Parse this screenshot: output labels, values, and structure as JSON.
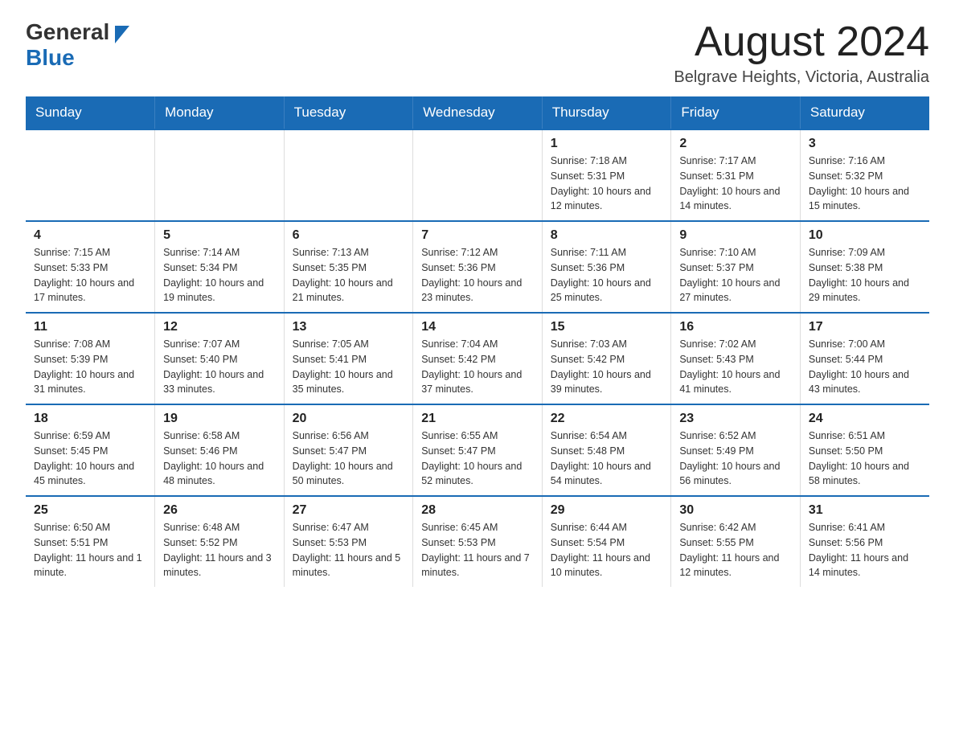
{
  "header": {
    "logo_general": "General",
    "logo_blue": "Blue",
    "month_title": "August 2024",
    "location": "Belgrave Heights, Victoria, Australia"
  },
  "days_of_week": [
    "Sunday",
    "Monday",
    "Tuesday",
    "Wednesday",
    "Thursday",
    "Friday",
    "Saturday"
  ],
  "weeks": [
    [
      {
        "day": "",
        "info": ""
      },
      {
        "day": "",
        "info": ""
      },
      {
        "day": "",
        "info": ""
      },
      {
        "day": "",
        "info": ""
      },
      {
        "day": "1",
        "info": "Sunrise: 7:18 AM\nSunset: 5:31 PM\nDaylight: 10 hours and 12 minutes."
      },
      {
        "day": "2",
        "info": "Sunrise: 7:17 AM\nSunset: 5:31 PM\nDaylight: 10 hours and 14 minutes."
      },
      {
        "day": "3",
        "info": "Sunrise: 7:16 AM\nSunset: 5:32 PM\nDaylight: 10 hours and 15 minutes."
      }
    ],
    [
      {
        "day": "4",
        "info": "Sunrise: 7:15 AM\nSunset: 5:33 PM\nDaylight: 10 hours and 17 minutes."
      },
      {
        "day": "5",
        "info": "Sunrise: 7:14 AM\nSunset: 5:34 PM\nDaylight: 10 hours and 19 minutes."
      },
      {
        "day": "6",
        "info": "Sunrise: 7:13 AM\nSunset: 5:35 PM\nDaylight: 10 hours and 21 minutes."
      },
      {
        "day": "7",
        "info": "Sunrise: 7:12 AM\nSunset: 5:36 PM\nDaylight: 10 hours and 23 minutes."
      },
      {
        "day": "8",
        "info": "Sunrise: 7:11 AM\nSunset: 5:36 PM\nDaylight: 10 hours and 25 minutes."
      },
      {
        "day": "9",
        "info": "Sunrise: 7:10 AM\nSunset: 5:37 PM\nDaylight: 10 hours and 27 minutes."
      },
      {
        "day": "10",
        "info": "Sunrise: 7:09 AM\nSunset: 5:38 PM\nDaylight: 10 hours and 29 minutes."
      }
    ],
    [
      {
        "day": "11",
        "info": "Sunrise: 7:08 AM\nSunset: 5:39 PM\nDaylight: 10 hours and 31 minutes."
      },
      {
        "day": "12",
        "info": "Sunrise: 7:07 AM\nSunset: 5:40 PM\nDaylight: 10 hours and 33 minutes."
      },
      {
        "day": "13",
        "info": "Sunrise: 7:05 AM\nSunset: 5:41 PM\nDaylight: 10 hours and 35 minutes."
      },
      {
        "day": "14",
        "info": "Sunrise: 7:04 AM\nSunset: 5:42 PM\nDaylight: 10 hours and 37 minutes."
      },
      {
        "day": "15",
        "info": "Sunrise: 7:03 AM\nSunset: 5:42 PM\nDaylight: 10 hours and 39 minutes."
      },
      {
        "day": "16",
        "info": "Sunrise: 7:02 AM\nSunset: 5:43 PM\nDaylight: 10 hours and 41 minutes."
      },
      {
        "day": "17",
        "info": "Sunrise: 7:00 AM\nSunset: 5:44 PM\nDaylight: 10 hours and 43 minutes."
      }
    ],
    [
      {
        "day": "18",
        "info": "Sunrise: 6:59 AM\nSunset: 5:45 PM\nDaylight: 10 hours and 45 minutes."
      },
      {
        "day": "19",
        "info": "Sunrise: 6:58 AM\nSunset: 5:46 PM\nDaylight: 10 hours and 48 minutes."
      },
      {
        "day": "20",
        "info": "Sunrise: 6:56 AM\nSunset: 5:47 PM\nDaylight: 10 hours and 50 minutes."
      },
      {
        "day": "21",
        "info": "Sunrise: 6:55 AM\nSunset: 5:47 PM\nDaylight: 10 hours and 52 minutes."
      },
      {
        "day": "22",
        "info": "Sunrise: 6:54 AM\nSunset: 5:48 PM\nDaylight: 10 hours and 54 minutes."
      },
      {
        "day": "23",
        "info": "Sunrise: 6:52 AM\nSunset: 5:49 PM\nDaylight: 10 hours and 56 minutes."
      },
      {
        "day": "24",
        "info": "Sunrise: 6:51 AM\nSunset: 5:50 PM\nDaylight: 10 hours and 58 minutes."
      }
    ],
    [
      {
        "day": "25",
        "info": "Sunrise: 6:50 AM\nSunset: 5:51 PM\nDaylight: 11 hours and 1 minute."
      },
      {
        "day": "26",
        "info": "Sunrise: 6:48 AM\nSunset: 5:52 PM\nDaylight: 11 hours and 3 minutes."
      },
      {
        "day": "27",
        "info": "Sunrise: 6:47 AM\nSunset: 5:53 PM\nDaylight: 11 hours and 5 minutes."
      },
      {
        "day": "28",
        "info": "Sunrise: 6:45 AM\nSunset: 5:53 PM\nDaylight: 11 hours and 7 minutes."
      },
      {
        "day": "29",
        "info": "Sunrise: 6:44 AM\nSunset: 5:54 PM\nDaylight: 11 hours and 10 minutes."
      },
      {
        "day": "30",
        "info": "Sunrise: 6:42 AM\nSunset: 5:55 PM\nDaylight: 11 hours and 12 minutes."
      },
      {
        "day": "31",
        "info": "Sunrise: 6:41 AM\nSunset: 5:56 PM\nDaylight: 11 hours and 14 minutes."
      }
    ]
  ]
}
